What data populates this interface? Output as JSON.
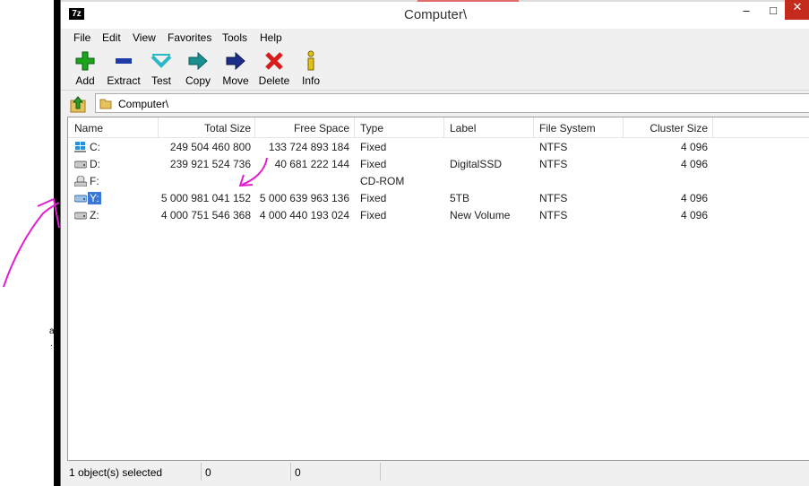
{
  "window": {
    "title": "Computer\\",
    "app_icon": "7z",
    "min": "–",
    "max": "□",
    "close": "✕"
  },
  "menu": [
    "File",
    "Edit",
    "View",
    "Favorites",
    "Tools",
    "Help"
  ],
  "toolbar": [
    {
      "label": "Add",
      "icon": "add-icon",
      "color": "#1aa51a"
    },
    {
      "label": "Extract",
      "icon": "extract-icon",
      "color": "#1f3ba8"
    },
    {
      "label": "Test",
      "icon": "test-icon",
      "color": "#2ab8c7"
    },
    {
      "label": "Copy",
      "icon": "copy-icon",
      "color": "#1a8f8f"
    },
    {
      "label": "Move",
      "icon": "move-icon",
      "color": "#1c2f8a"
    },
    {
      "label": "Delete",
      "icon": "delete-icon",
      "color": "#d81b1b"
    },
    {
      "label": "Info",
      "icon": "info-icon",
      "color": "#e0c21a"
    }
  ],
  "address": {
    "path": "Computer\\"
  },
  "columns": [
    "Name",
    "Total Size",
    "Free Space",
    "Type",
    "Label",
    "File System",
    "Cluster Size"
  ],
  "rows": [
    {
      "name": "C:",
      "total": "249 504 460 800",
      "free": "133 724 893 184",
      "type": "Fixed",
      "label": "",
      "fs": "NTFS",
      "cluster": "4 096",
      "icon": "windows-drive-icon"
    },
    {
      "name": "D:",
      "total": "239 921 524 736",
      "free": "40 681 222 144",
      "type": "Fixed",
      "label": "DigitalSSD",
      "fs": "NTFS",
      "cluster": "4 096",
      "icon": "hard-drive-icon"
    },
    {
      "name": "F:",
      "total": "",
      "free": "",
      "type": "CD-ROM",
      "label": "",
      "fs": "",
      "cluster": "",
      "icon": "cdrom-drive-icon"
    },
    {
      "name": "Y:",
      "total": "5 000 981 041 152",
      "free": "5 000 639 963 136",
      "type": "Fixed",
      "label": "5TB",
      "fs": "NTFS",
      "cluster": "4 096",
      "icon": "hard-drive-icon",
      "selected": true
    },
    {
      "name": "Z:",
      "total": "4 000 751 546 368",
      "free": "4 000 440 193 024",
      "type": "Fixed",
      "label": "New Volume",
      "fs": "NTFS",
      "cluster": "4 096",
      "icon": "hard-drive-icon"
    }
  ],
  "status": {
    "selected": "1 object(s) selected",
    "size": "0",
    "packed": "0"
  },
  "annotation": {
    "color": "#e020d0"
  },
  "fragments": [
    "a",
    "."
  ]
}
